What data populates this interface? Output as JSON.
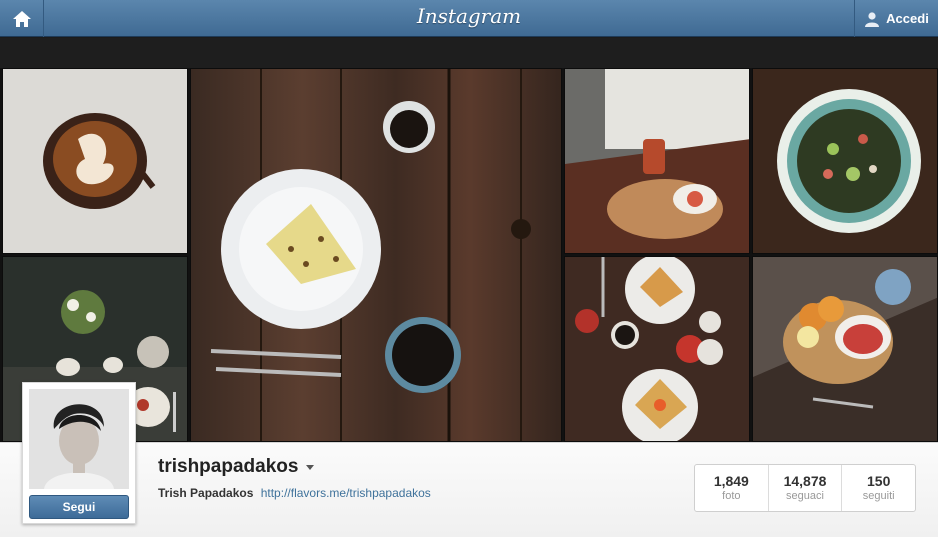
{
  "header": {
    "logo_text": "Instagram",
    "home_icon": "home-icon",
    "login_label": "Accedi",
    "login_icon": "user-icon"
  },
  "photos": [
    {
      "name": "latte-art-swan"
    },
    {
      "name": "pancake-on-wood-table"
    },
    {
      "name": "kitchen-window-board"
    },
    {
      "name": "salad-bowl"
    },
    {
      "name": "flowers-breakfast-table"
    },
    {
      "name": "crepes-table-top"
    },
    {
      "name": "breakfast-board-oranges"
    }
  ],
  "profile": {
    "username": "trishpapadakos",
    "full_name": "Trish Papadakos",
    "link": "http://flavors.me/trishpapadakos",
    "follow_label": "Segui",
    "stats": [
      {
        "value": "1,849",
        "label": "foto"
      },
      {
        "value": "14,878",
        "label": "seguaci"
      },
      {
        "value": "150",
        "label": "seguiti"
      }
    ]
  },
  "colors": {
    "topbar": "#4f7aa2",
    "link": "#3f729b",
    "follow_button": "#4a77a3"
  }
}
